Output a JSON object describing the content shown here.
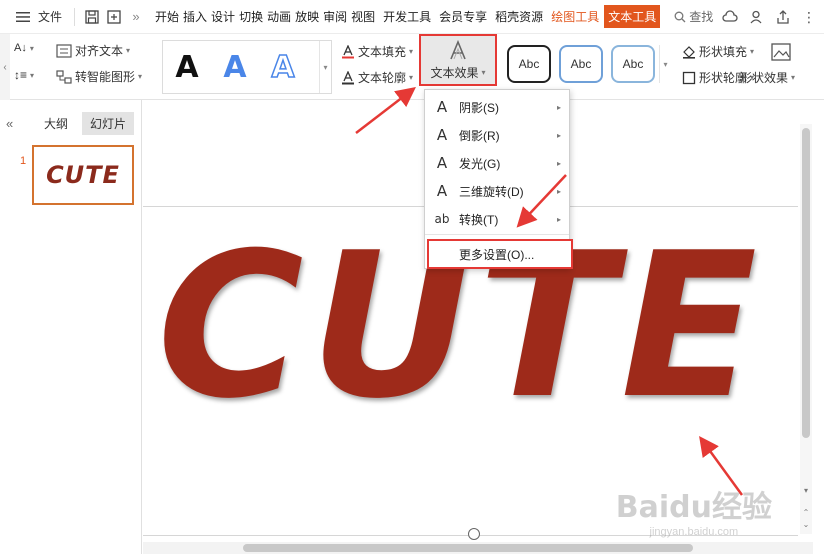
{
  "menubar": {
    "file_label": "文件",
    "tabs": [
      "开始",
      "插入",
      "设计",
      "切换",
      "动画",
      "放映",
      "审阅",
      "视图",
      "开发工具",
      "会员专享",
      "稻壳资源"
    ],
    "drawing_tools_tab": "绘图工具",
    "text_tools_tab": "文本工具",
    "search_label": "查找"
  },
  "ribbon": {
    "align_text": "对齐文本",
    "convert_smartart": "转智能图形",
    "wordart_letter": "A",
    "text_fill": "文本填充",
    "text_outline": "文本轮廓",
    "text_effect": "文本效果",
    "abc_label": "Abc",
    "shape_fill": "形状填充",
    "shape_outline": "形状轮廓",
    "shape_effect": "形状效果"
  },
  "panel": {
    "tab_outline": "大纲",
    "tab_slides": "幻灯片",
    "slide_number": "1",
    "thumb_text": "CUTE"
  },
  "slide": {
    "text": "CUTE"
  },
  "dropdown": {
    "items": [
      {
        "icon": "A",
        "label": "阴影(S)"
      },
      {
        "icon": "A",
        "label": "倒影(R)"
      },
      {
        "icon": "A",
        "label": "发光(G)"
      },
      {
        "icon": "A",
        "label": "三维旋转(D)"
      },
      {
        "icon": "ab",
        "label": "转换(T)"
      }
    ],
    "more_settings": "更多设置(O)..."
  },
  "watermark": {
    "logo": "Baidu经验",
    "url": "jingyan.baidu.com"
  },
  "colors": {
    "accent": "#e2561d",
    "highlight_red": "#e53935",
    "text_red": "#9e2a1a"
  }
}
